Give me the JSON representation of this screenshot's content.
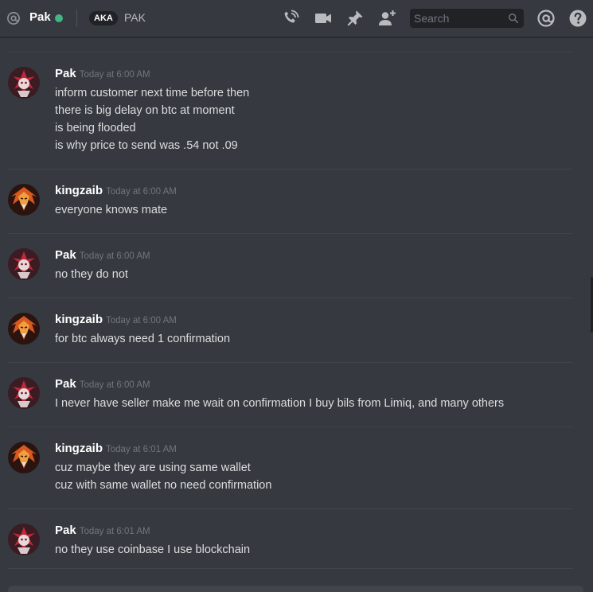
{
  "header": {
    "dm_name": "Pak",
    "status_color": "#43b581",
    "aka_label": "AKA",
    "aka_name": "PAK",
    "icons": [
      "at-icon",
      "call-icon",
      "video-icon",
      "pin-icon",
      "add-friend-icon",
      "search-icon",
      "mention-icon",
      "help-icon"
    ]
  },
  "search": {
    "placeholder": "Search"
  },
  "messages": [
    {
      "user": "Pak",
      "avatar": "pak-avatar",
      "time": "Today at 6:00 AM",
      "lines": [
        "inform customer next time before then",
        "there is big delay on btc at moment",
        "is being flooded",
        "is why price to send was .54 not .09"
      ]
    },
    {
      "user": "kingzaib",
      "avatar": "kingzaib-avatar",
      "time": "Today at 6:00 AM",
      "lines": [
        "everyone knows mate"
      ]
    },
    {
      "user": "Pak",
      "avatar": "pak-avatar",
      "time": "Today at 6:00 AM",
      "lines": [
        "no they do not"
      ]
    },
    {
      "user": "kingzaib",
      "avatar": "kingzaib-avatar",
      "time": "Today at 6:00 AM",
      "lines": [
        "for btc always need 1 confirmation"
      ]
    },
    {
      "user": "Pak",
      "avatar": "pak-avatar",
      "time": "Today at 6:00 AM",
      "lines": [
        "I never have seller make me wait on confirmation I buy bils from Limiq, and many others"
      ]
    },
    {
      "user": "kingzaib",
      "avatar": "kingzaib-avatar",
      "time": "Today at 6:01 AM",
      "lines": [
        "cuz maybe they are using same wallet",
        "cuz with same wallet no need confirmation"
      ]
    },
    {
      "user": "Pak",
      "avatar": "pak-avatar",
      "time": "Today at 6:01 AM",
      "lines": [
        "no they use coinbase I use blockchain"
      ]
    }
  ]
}
